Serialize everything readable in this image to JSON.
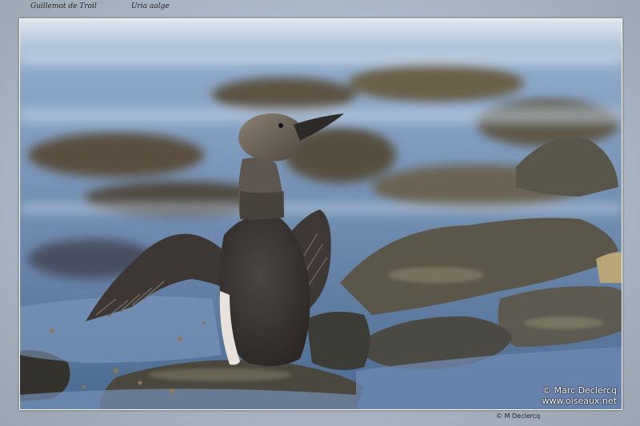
{
  "caption": {
    "common_name": "Guillemot de Troil",
    "latin_name": "Uria  aalge"
  },
  "photo": {
    "watermark_line1": "© Marc Declercq",
    "watermark_line2": "www.oiseaux.net"
  },
  "footer": {
    "credit": "© M Declercq"
  },
  "colors": {
    "water": "#6f8fb6",
    "rock": "#4a4b44",
    "bird_head": "#6a6258",
    "bird_wing": "#3a3532"
  }
}
